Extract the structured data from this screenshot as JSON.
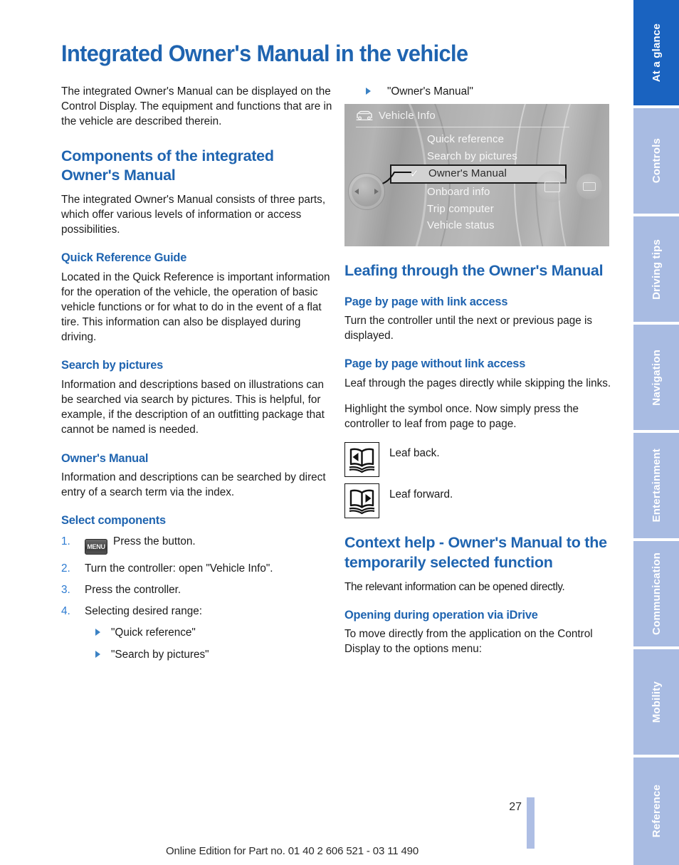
{
  "page": {
    "title": "Integrated Owner's Manual in the vehicle",
    "number": "27",
    "footer": "Online Edition for Part no. 01 40 2 606 521 - 03 11 490",
    "accent_blue": "#1f64b0",
    "tab_active_blue": "#1a63c0",
    "tab_inactive_blue": "#a8bbe2"
  },
  "left_column": {
    "intro": "The integrated Owner's Manual can be displayed on the Control Display. The equipment and functions that are in the vehicle are described therein.",
    "components_heading": "Components of the integrated Owner's Manual",
    "components_body": "The integrated Owner's Manual consists of three parts, which offer various levels of information or access possibilities.",
    "quick_reference_heading": "Quick Reference Guide",
    "quick_reference_body": "Located in the Quick Reference is important information for the operation of the vehicle, the operation of basic vehicle functions or for what to do in the event of a flat tire. This information can also be displayed during driving.",
    "search_pictures_heading": "Search by pictures",
    "search_pictures_body": "Information and descriptions based on illustrations can be searched via search by pictures. This is helpful, for example, if the description of an outfitting package that cannot be named is needed.",
    "owners_manual_heading": "Owner's Manual",
    "owners_manual_body": "Information and descriptions can be searched by direct entry of a search term via the index.",
    "select_components_heading": "Select components",
    "steps": [
      {
        "num": "1.",
        "key": "MENU",
        "text": "Press the button."
      },
      {
        "num": "2.",
        "key": "",
        "text": "Turn the controller: open \"Vehicle Info\"."
      },
      {
        "num": "3.",
        "key": "",
        "text": "Press the controller."
      },
      {
        "num": "4.",
        "key": "",
        "text": "Selecting desired range:"
      }
    ],
    "range_options": [
      "\"Quick reference\"",
      "\"Search by pictures\""
    ]
  },
  "right_column": {
    "range_option_continued": "\"Owner's Manual\"",
    "idrive": {
      "header_icon": "car-front-icon",
      "header_title": "Vehicle Info",
      "items": [
        {
          "label": "Quick reference",
          "selected": false
        },
        {
          "label": "Search by pictures",
          "selected": false
        },
        {
          "label": "Owner's Manual",
          "selected": true,
          "check": "✓"
        },
        {
          "label": "Onboard info",
          "selected": false
        },
        {
          "label": "Trip computer",
          "selected": false
        },
        {
          "label": "Vehicle status",
          "selected": false
        }
      ]
    },
    "leafing_heading": "Leafing through the Owner's Manual",
    "with_link_heading": "Page by page with link access",
    "with_link_body": "Turn the controller until the next or previous page is displayed.",
    "without_link_heading": "Page by page without link access",
    "without_link_body_1": "Leaf through the pages directly while skipping the links.",
    "without_link_body_2": "Highlight the symbol once. Now simply press the controller to leaf from page to page.",
    "leaf_back_label": "Leaf back.",
    "leaf_forward_label": "Leaf forward.",
    "context_help_heading": "Context help - Owner's Manual to the temporarily selected function",
    "context_help_body": "The relevant information can be opened directly.",
    "opening_heading": "Opening during operation via iDrive",
    "opening_body": "To move directly from the application on the Control Display to the options menu:"
  },
  "sidebar": {
    "tabs": [
      {
        "label": "At a glance",
        "active": true
      },
      {
        "label": "Controls",
        "active": false
      },
      {
        "label": "Driving tips",
        "active": false
      },
      {
        "label": "Navigation",
        "active": false
      },
      {
        "label": "Entertainment",
        "active": false
      },
      {
        "label": "Communication",
        "active": false
      },
      {
        "label": "Mobility",
        "active": false
      },
      {
        "label": "Reference",
        "active": false
      }
    ]
  }
}
